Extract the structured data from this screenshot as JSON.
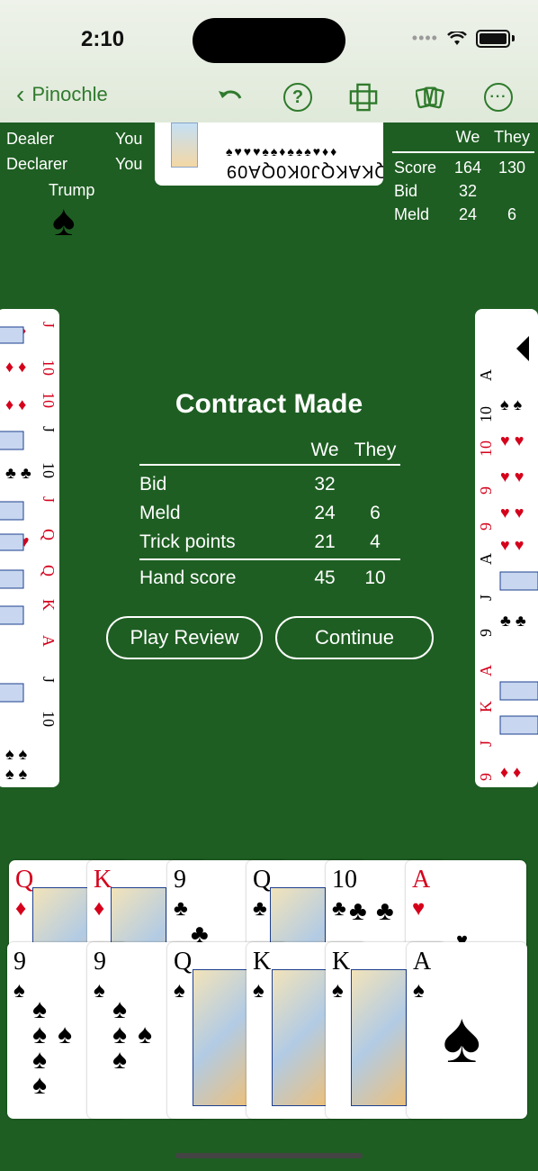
{
  "status": {
    "time": "2:10"
  },
  "nav": {
    "back_label": "Pinochle"
  },
  "info": {
    "dealer_label": "Dealer",
    "dealer": "You",
    "declarer_label": "Declarer",
    "declarer": "You",
    "trump_label": "Trump",
    "trump_suit": "♠"
  },
  "score": {
    "header_we": "We",
    "header_they": "They",
    "rows": [
      {
        "label": "Score",
        "we": "164",
        "they": "130"
      },
      {
        "label": "Bid",
        "we": "32",
        "they": ""
      },
      {
        "label": "Meld",
        "we": "24",
        "they": "6"
      }
    ]
  },
  "north_hand": {
    "ranks": "JQKAKQJ0K0QA09",
    "suits": "♠♥♥♥♠♠♦♠♠♠♥♦♦"
  },
  "dialog": {
    "title": "Contract Made",
    "header_we": "We",
    "header_they": "They",
    "rows": [
      {
        "label": "Bid",
        "we": "32",
        "they": ""
      },
      {
        "label": "Meld",
        "we": "24",
        "they": "6"
      },
      {
        "label": "Trick points",
        "we": "21",
        "they": "4"
      }
    ],
    "total": {
      "label": "Hand score",
      "we": "45",
      "they": "10"
    },
    "play_review": "Play Review",
    "continue": "Continue"
  },
  "south_row1": [
    {
      "rank": "Q",
      "suit": "♦",
      "color": "red"
    },
    {
      "rank": "K",
      "suit": "♦",
      "color": "red"
    },
    {
      "rank": "9",
      "suit": "♣",
      "color": "blk"
    },
    {
      "rank": "Q",
      "suit": "♣",
      "color": "blk"
    },
    {
      "rank": "10",
      "suit": "♣",
      "color": "blk"
    },
    {
      "rank": "A",
      "suit": "♥",
      "color": "red"
    }
  ],
  "south_row2": [
    {
      "rank": "9",
      "suit": "♠",
      "color": "blk"
    },
    {
      "rank": "9",
      "suit": "♠",
      "color": "blk"
    },
    {
      "rank": "Q",
      "suit": "♠",
      "color": "blk"
    },
    {
      "rank": "K",
      "suit": "♠",
      "color": "blk"
    },
    {
      "rank": "K",
      "suit": "♠",
      "color": "blk"
    },
    {
      "rank": "A",
      "suit": "♠",
      "color": "blk"
    }
  ]
}
